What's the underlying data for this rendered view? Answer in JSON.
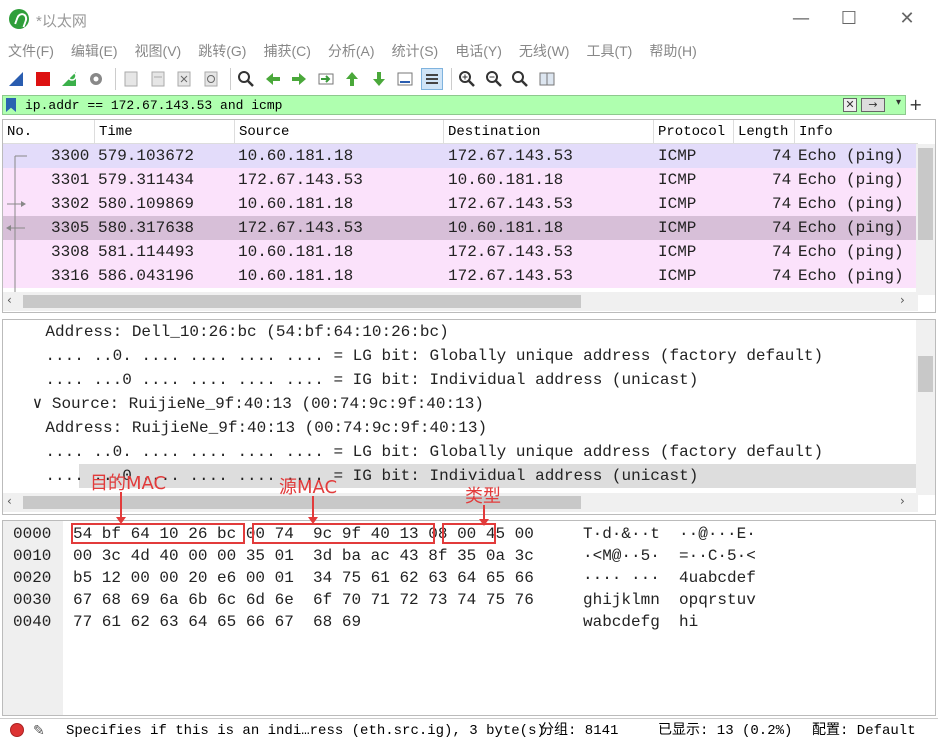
{
  "window": {
    "title": "*以太网",
    "minimize": "—",
    "maximize": "☐",
    "close": "✕"
  },
  "menu": [
    "文件(F)",
    "编辑(E)",
    "视图(V)",
    "跳转(G)",
    "捕获(C)",
    "分析(A)",
    "统计(S)",
    "电话(Y)",
    "无线(W)",
    "工具(T)",
    "帮助(H)"
  ],
  "toolbar": {
    "icons": [
      "shark-fin-icon",
      "stop-icon",
      "restart-icon",
      "options-gear-icon",
      "open-icon",
      "save-icon",
      "close-file-icon",
      "reload-icon",
      "find-icon",
      "back-icon",
      "forward-icon",
      "goto-icon",
      "first-packet-icon",
      "last-packet-icon",
      "autoscroll-icon",
      "colorize-icon",
      "zoom-in-icon",
      "zoom-out-icon",
      "zoom-reset-icon",
      "resize-columns-icon"
    ]
  },
  "filter": {
    "value": "ip.addr == 172.67.143.53 and icmp",
    "clear": "✕",
    "apply": "→",
    "dropdown": "▾",
    "add": "+"
  },
  "packet_list": {
    "columns": [
      "No.",
      "Time",
      "Source",
      "Destination",
      "Protocol",
      "Length",
      "Info"
    ],
    "rows": [
      {
        "no": "3300",
        "time": "579.103672",
        "source": "10.60.181.18",
        "destination": "172.67.143.53",
        "protocol": "ICMP",
        "length": "74",
        "info": "Echo (ping)"
      },
      {
        "no": "3301",
        "time": "579.311434",
        "source": "172.67.143.53",
        "destination": "10.60.181.18",
        "protocol": "ICMP",
        "length": "74",
        "info": "Echo (ping)"
      },
      {
        "no": "3302",
        "time": "580.109869",
        "source": "10.60.181.18",
        "destination": "172.67.143.53",
        "protocol": "ICMP",
        "length": "74",
        "info": "Echo (ping)"
      },
      {
        "no": "3305",
        "time": "580.317638",
        "source": "172.67.143.53",
        "destination": "10.60.181.18",
        "protocol": "ICMP",
        "length": "74",
        "info": "Echo (ping)"
      },
      {
        "no": "3308",
        "time": "581.114493",
        "source": "10.60.181.18",
        "destination": "172.67.143.53",
        "protocol": "ICMP",
        "length": "74",
        "info": "Echo (ping)"
      },
      {
        "no": "3316",
        "time": "586.043196",
        "source": "10.60.181.18",
        "destination": "172.67.143.53",
        "protocol": "ICMP",
        "length": "74",
        "info": "Echo (ping)"
      }
    ],
    "row_colors": [
      "#e3dcfa",
      "#fbe2fb",
      "#fbe2fb",
      "#d7bfd8",
      "#fbe2fb",
      "#fbe2fb"
    ]
  },
  "details": {
    "lines": [
      "    Address: Dell_10:26:bc (54:bf:64:10:26:bc)",
      "    .... ..0. .... .... .... .... = LG bit: Globally unique address (factory default)",
      "    .... ...0 .... .... .... .... = IG bit: Individual address (unicast)",
      " ∨ Source: RuijieNe_9f:40:13 (00:74:9c:9f:40:13)",
      "    Address: RuijieNe_9f:40:13 (00:74:9c:9f:40:13)",
      "    .... ..0. .... .... .... .... = LG bit: Globally unique address (factory default)",
      "    .... ...0 .... .... .... .... = IG bit: Individual address (unicast)"
    ],
    "selected_index": 6
  },
  "bytes": {
    "rows": [
      {
        "offset": "0000",
        "hex": "54 bf 64 10 26 bc 00 74  9c 9f 40 13 08 00 45 00",
        "ascii": "T·d·&··t  ··@···E·"
      },
      {
        "offset": "0010",
        "hex": "00 3c 4d 40 00 00 35 01  3d ba ac 43 8f 35 0a 3c",
        "ascii": "·<M@··5·  =··C·5·<"
      },
      {
        "offset": "0020",
        "hex": "b5 12 00 00 20 e6 00 01  34 75 61 62 63 64 65 66",
        "ascii": "···· ···  4uabcdef"
      },
      {
        "offset": "0030",
        "hex": "67 68 69 6a 6b 6c 6d 6e  6f 70 71 72 73 74 75 76",
        "ascii": "ghijklmn  opqrstuv"
      },
      {
        "offset": "0040",
        "hex": "77 61 62 63 64 65 66 67  68 69",
        "ascii": "wabcdefg  hi"
      }
    ],
    "annotations": [
      {
        "label": "目的MAC"
      },
      {
        "label": "源MAC"
      },
      {
        "label": "类型"
      }
    ]
  },
  "status": {
    "message": "Specifies if this is an indi…ress (eth.src.ig), 3 byte(s)",
    "packets": "分组: 8141",
    "displayed": "已显示: 13 (0.2%)",
    "profile": "配置: Default"
  }
}
